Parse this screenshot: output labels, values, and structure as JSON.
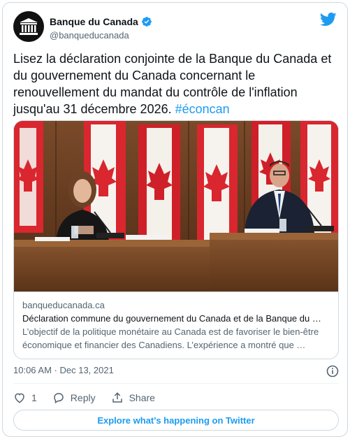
{
  "account": {
    "name": "Banque du Canada",
    "handle": "@banqueducanada",
    "verified": true
  },
  "tweet": {
    "text": "Lisez la déclaration conjointe de la Banque du Canada et du gouvernement du Canada concernant le renouvellement du mandat du contrôle de l'inflation jusqu'au 31 décembre 2026.",
    "hashtag": "#éconcan"
  },
  "link_card": {
    "domain": "banqueducanada.ca",
    "title": "Déclaration commune du gouvernement du Canada et de la Banque du …",
    "description": "L’objectif de la politique monétaire au Canada est de favoriser le bien-être économique et financier des Canadiens. L’expérience a montré que …"
  },
  "meta": {
    "timestamp": "10:06 AM · Dec 13, 2021"
  },
  "actions": {
    "like_count": "1",
    "reply_label": "Reply",
    "share_label": "Share"
  },
  "explore_label": "Explore what's happening on Twitter",
  "colors": {
    "accent": "#1d9bf0",
    "text": "#0f1419",
    "secondary": "#536471",
    "border": "#cfd9de"
  }
}
